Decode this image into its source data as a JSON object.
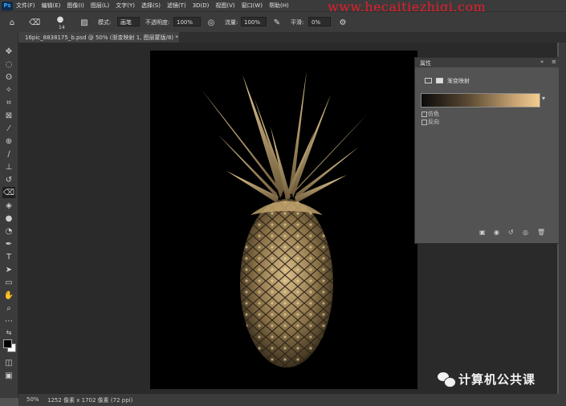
{
  "menubar": {
    "logo": "Ps",
    "items": [
      "文件(F)",
      "编辑(E)",
      "图像(I)",
      "图层(L)",
      "文字(Y)",
      "选择(S)",
      "滤镜(T)",
      "3D(D)",
      "视图(V)",
      "窗口(W)",
      "帮助(H)"
    ],
    "watermark_url": "www.hecaitiezhiqi.com"
  },
  "options": {
    "brush_size": "14",
    "mode_label": "模式:",
    "mode_value": "画笔",
    "opacity_label": "不透明度:",
    "opacity_value": "100%",
    "flow_label": "流量:",
    "flow_value": "100%",
    "smooth_label": "平滑:",
    "smooth_value": "0%"
  },
  "document": {
    "tab_title": "16pic_8838175_b.psd @ 50% (渐变映射 1, 图层蒙版/8) *"
  },
  "properties": {
    "title": "属性",
    "layer_name": "渐变映射",
    "dither_label": "仿色",
    "reverse_label": "反向",
    "gradient_colors": [
      "#0a0a0a",
      "#5b4933",
      "#caa675",
      "#f3cc8f"
    ]
  },
  "statusbar": {
    "zoom": "50%",
    "dimensions": "1252 像素 x 1702 像素 (72 ppi)"
  },
  "watermark": {
    "text": "计算机公共课"
  },
  "colors": {
    "foreground": "#000000",
    "background": "#ffffff",
    "pineapple_light": "#f0d29a",
    "pineapple_dark": "#4a3c27"
  }
}
